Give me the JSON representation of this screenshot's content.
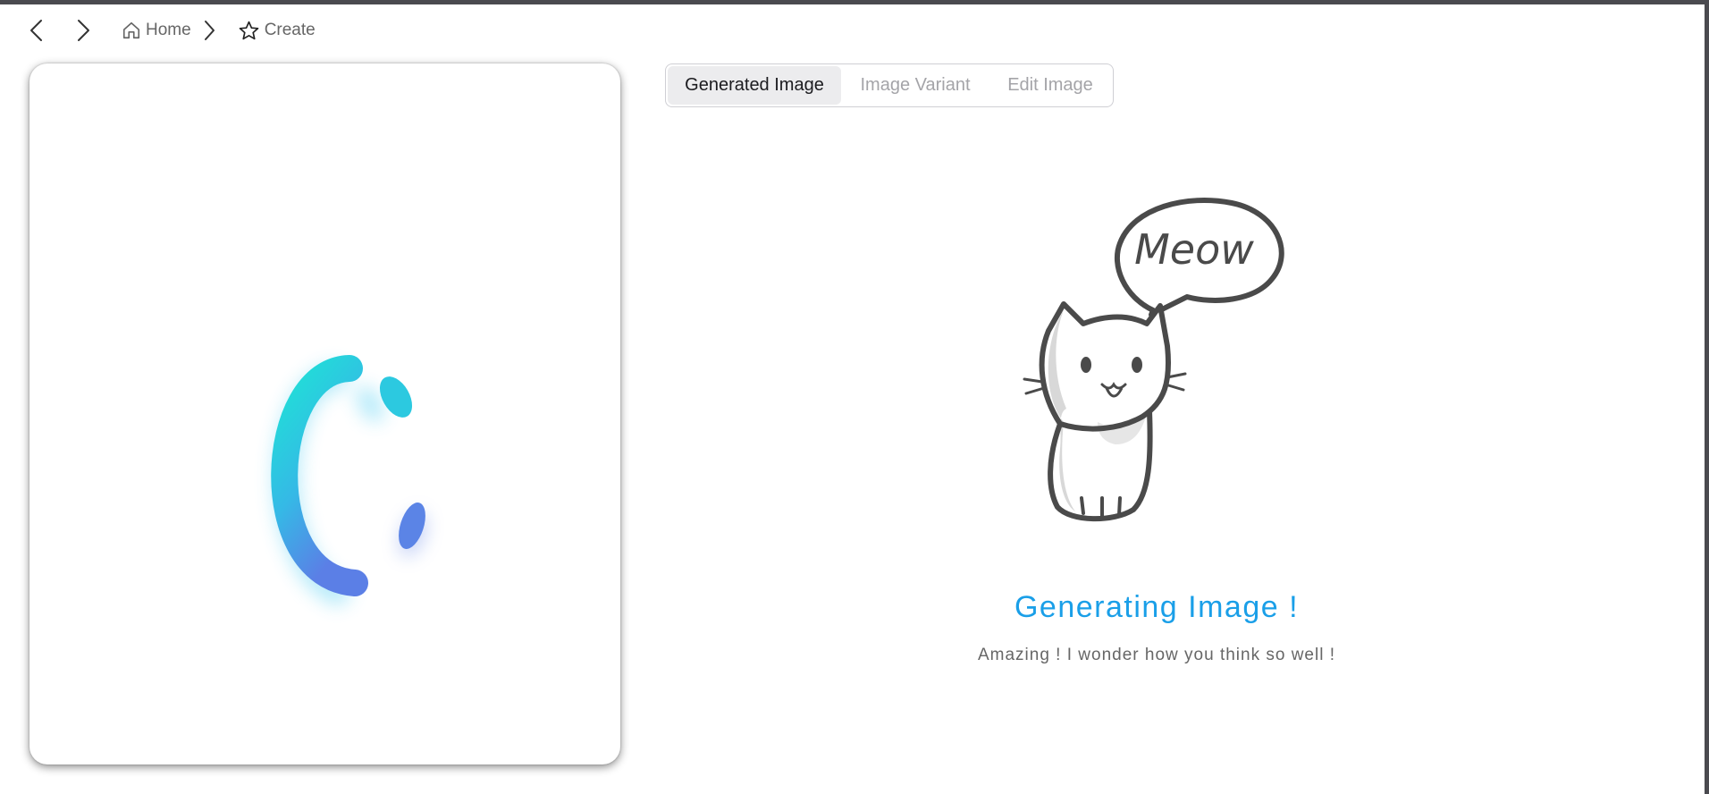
{
  "breadcrumb": {
    "home_label": "Home",
    "create_label": "Create"
  },
  "tabs": [
    {
      "label": "Generated Image",
      "active": true
    },
    {
      "label": "Image Variant",
      "active": false
    },
    {
      "label": "Edit Image",
      "active": false
    }
  ],
  "illustration": {
    "speech_bubble_text": "Meow"
  },
  "status": {
    "title": "Generating Image !",
    "subtitle": "Amazing ! I wonder how you think so well !"
  },
  "icons": {
    "back": "chevron-left-icon",
    "forward": "chevron-right-icon",
    "home": "home-icon",
    "create": "star-icon",
    "separator": "chevron-right-icon"
  },
  "colors": {
    "accent": "#1a9fe8",
    "loader_start": "#1ee3d6",
    "loader_end": "#5b7fe6",
    "tab_active_bg": "#ececee",
    "muted_text": "#a4a4a8"
  }
}
